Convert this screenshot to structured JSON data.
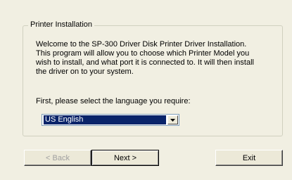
{
  "group": {
    "title": "Printer Installation",
    "welcome_text": "Welcome to the SP-300 Driver Disk Printer Driver Installation.\nThis program will allow you to choose which Printer Model you\nwish to install, and what port it is connected to. It will then install\nthe driver on to your system.",
    "language_prompt": "First, please select the language you require:",
    "language_selected": "US English"
  },
  "buttons": {
    "back_label": "< Back",
    "next_label": "Next >",
    "exit_label": "Exit"
  },
  "icons": {
    "dropdown": "chevron-down-icon"
  }
}
